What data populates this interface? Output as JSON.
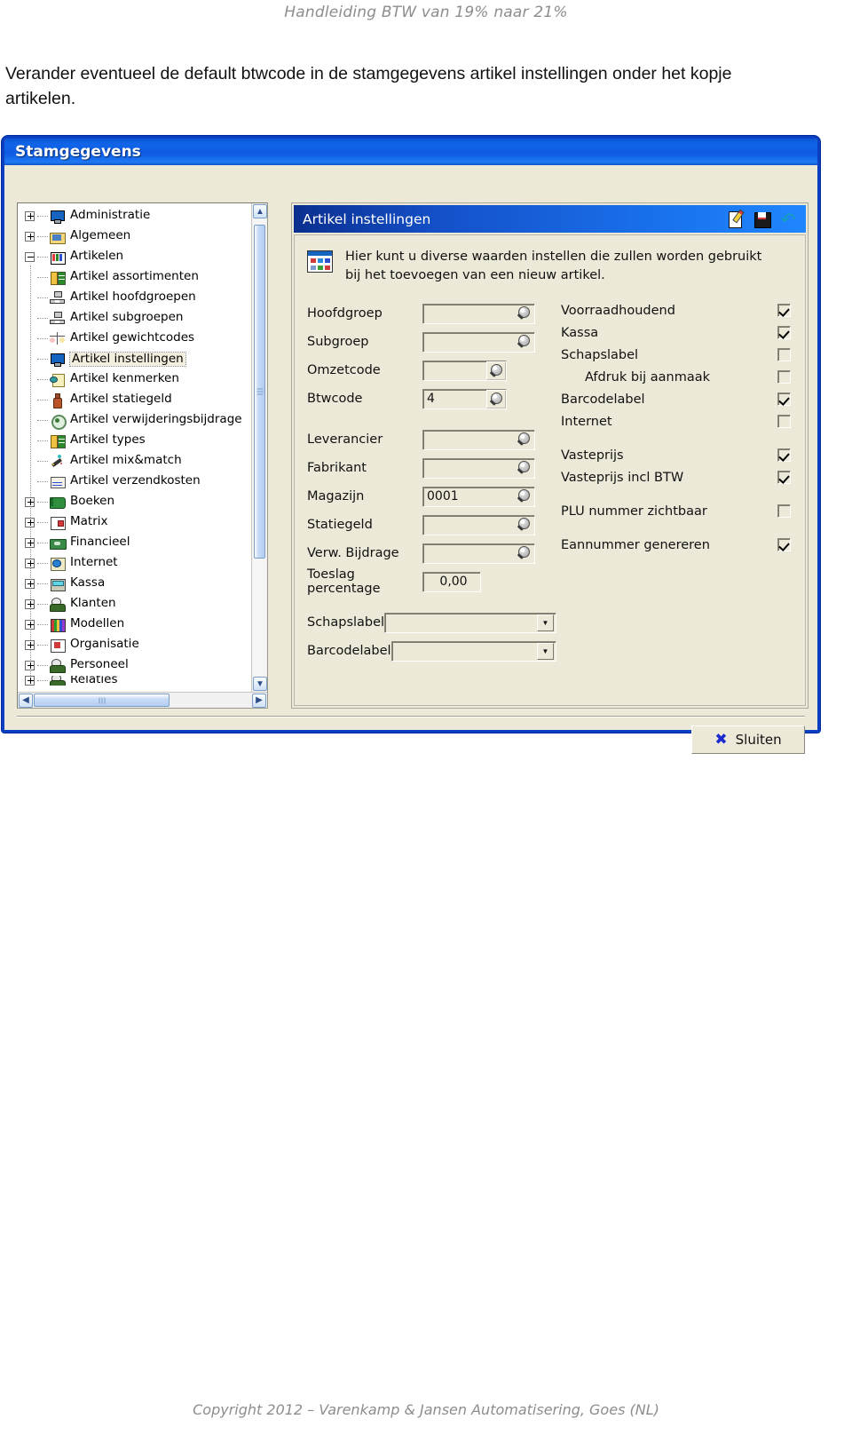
{
  "document": {
    "header": "Handleiding BTW van 19% naar 21%",
    "paragraph": "Verander eventueel de default btwcode in de stamgegevens artikel instellingen onder het kopje artikelen.",
    "footer": "Copyright 2012 – Varenkamp & Jansen Automatisering, Goes (NL)"
  },
  "window": {
    "title": "Stamgegevens",
    "colors": {
      "titlebar_blue": "#1165e8",
      "frame_blue": "#0a3fc2",
      "face": "#ece9d8",
      "accent_panel": "#1450c8"
    }
  },
  "tree": {
    "nodes": [
      {
        "label": "Administratie",
        "level": 0,
        "expander": "plus",
        "icon": "monitor-icon",
        "selected": false
      },
      {
        "label": "Algemeen",
        "level": 0,
        "expander": "plus",
        "icon": "folder-icon",
        "selected": false
      },
      {
        "label": "Artikelen",
        "level": 0,
        "expander": "minus",
        "icon": "grid-icon",
        "selected": false
      },
      {
        "label": "Artikel assortimenten",
        "level": 1,
        "expander": "none",
        "icon": "tree-icon",
        "selected": false
      },
      {
        "label": "Artikel hoofdgroepen",
        "level": 1,
        "expander": "none",
        "icon": "org-chart-icon",
        "selected": false
      },
      {
        "label": "Artikel subgroepen",
        "level": 1,
        "expander": "none",
        "icon": "org-chart-icon",
        "selected": false
      },
      {
        "label": "Artikel gewichtcodes",
        "level": 1,
        "expander": "none",
        "icon": "scale-icon",
        "selected": false
      },
      {
        "label": "Artikel instellingen",
        "level": 1,
        "expander": "none",
        "icon": "monitor-icon",
        "selected": true
      },
      {
        "label": "Artikel kenmerken",
        "level": 1,
        "expander": "none",
        "icon": "note-icon",
        "selected": false
      },
      {
        "label": "Artikel statiegeld",
        "level": 1,
        "expander": "none",
        "icon": "bottle-icon",
        "selected": false
      },
      {
        "label": "Artikel verwijderingsbijdrage",
        "level": 1,
        "expander": "none",
        "icon": "recycle-icon",
        "selected": false
      },
      {
        "label": "Artikel types",
        "level": 1,
        "expander": "none",
        "icon": "tree-icon",
        "selected": false
      },
      {
        "label": "Artikel mix&match",
        "level": 1,
        "expander": "none",
        "icon": "magic-wand-icon",
        "selected": false
      },
      {
        "label": "Artikel verzendkosten",
        "level": 1,
        "expander": "none",
        "icon": "envelope-icon",
        "selected": false
      },
      {
        "label": "Boeken",
        "level": 0,
        "expander": "plus",
        "icon": "book-icon",
        "selected": false
      },
      {
        "label": "Matrix",
        "level": 0,
        "expander": "plus",
        "icon": "matrix-icon",
        "selected": false
      },
      {
        "label": "Financieel",
        "level": 0,
        "expander": "plus",
        "icon": "money-icon",
        "selected": false
      },
      {
        "label": "Internet",
        "level": 0,
        "expander": "plus",
        "icon": "globe-icon",
        "selected": false
      },
      {
        "label": "Kassa",
        "level": 0,
        "expander": "plus",
        "icon": "register-icon",
        "selected": false
      },
      {
        "label": "Klanten",
        "level": 0,
        "expander": "plus",
        "icon": "people-icon",
        "selected": false
      },
      {
        "label": "Modellen",
        "level": 0,
        "expander": "plus",
        "icon": "stripes-icon",
        "selected": false
      },
      {
        "label": "Organisatie",
        "level": 0,
        "expander": "plus",
        "icon": "house-icon",
        "selected": false
      },
      {
        "label": "Personeel",
        "level": 0,
        "expander": "plus",
        "icon": "people-icon",
        "selected": false
      },
      {
        "label": "Relaties",
        "level": 0,
        "expander": "plus",
        "icon": "people-icon",
        "selected": false
      }
    ]
  },
  "panel": {
    "title": "Artikel instellingen",
    "toolbar": [
      {
        "icon": "new-document-icon"
      },
      {
        "icon": "save-icon"
      },
      {
        "icon": "undo-icon"
      }
    ],
    "info": {
      "icon": "settings-grid-icon",
      "line1": "Hier kunt u diverse waarden instellen die zullen worden gebruikt",
      "line2": "bij het toevoegen van een nieuw artikel."
    },
    "fields": [
      {
        "label": "Hoofdgroep",
        "value": "",
        "kind": "lookup-wide"
      },
      {
        "label": "Subgroep",
        "value": "",
        "kind": "lookup-wide"
      },
      {
        "label": "Omzetcode",
        "value": "",
        "kind": "lookup-narrow"
      },
      {
        "label": "Btwcode",
        "value": "4",
        "kind": "lookup-narrow"
      },
      {
        "label": "Leverancier",
        "value": "",
        "kind": "lookup-wide"
      },
      {
        "label": "Fabrikant",
        "value": "",
        "kind": "lookup-wide"
      },
      {
        "label": "Magazijn",
        "value": "0001",
        "kind": "lookup-wide"
      },
      {
        "label": "Statiegeld",
        "value": "",
        "kind": "lookup-wide"
      },
      {
        "label": "Verw. Bijdrage",
        "value": "",
        "kind": "lookup-wide"
      },
      {
        "label": "Toeslag percentage",
        "value": "0,00",
        "kind": "plain"
      }
    ],
    "combos": [
      {
        "label": "Schapslabel",
        "value": ""
      },
      {
        "label": "Barcodelabel",
        "value": ""
      }
    ],
    "checkboxes": [
      {
        "label": "Voorraadhoudend",
        "checked": true,
        "indent": false,
        "gap": false
      },
      {
        "label": "Kassa",
        "checked": true,
        "indent": false,
        "gap": false
      },
      {
        "label": "Schapslabel",
        "checked": false,
        "indent": false,
        "gap": false
      },
      {
        "label": "Afdruk bij aanmaak",
        "checked": false,
        "indent": true,
        "gap": false
      },
      {
        "label": "Barcodelabel",
        "checked": true,
        "indent": false,
        "gap": false
      },
      {
        "label": "Internet",
        "checked": false,
        "indent": false,
        "gap": false
      },
      {
        "label": "Vasteprijs",
        "checked": true,
        "indent": false,
        "gap": true
      },
      {
        "label": "Vasteprijs incl BTW",
        "checked": true,
        "indent": false,
        "gap": false
      },
      {
        "label": "PLU nummer zichtbaar",
        "checked": false,
        "indent": false,
        "gap": true
      },
      {
        "label": "Eannummer genereren",
        "checked": true,
        "indent": false,
        "gap": true
      }
    ],
    "close_button": {
      "label": "Sluiten",
      "icon": "close-x-icon"
    }
  },
  "scrollbars": {
    "vertical": {
      "up": "▲",
      "down": "▼"
    },
    "horizontal": {
      "left": "◀",
      "right": "▶"
    }
  }
}
